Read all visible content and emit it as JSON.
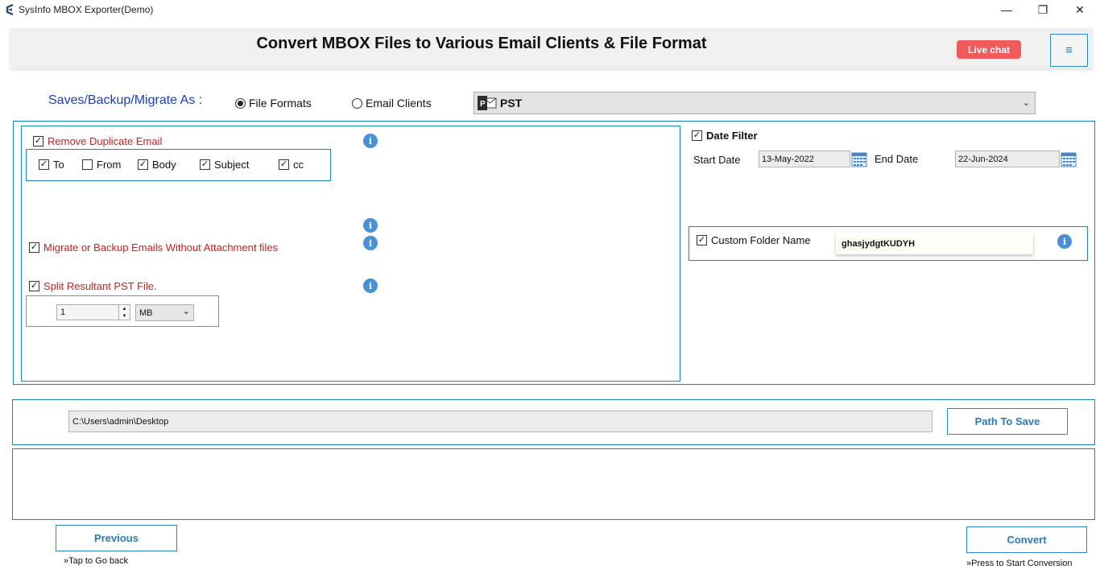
{
  "window": {
    "title": "SysInfo MBOX Exporter(Demo)",
    "minimize": "—",
    "restore": "❐",
    "close": "✕"
  },
  "header": {
    "title": "Convert MBOX Files to Various Email Clients & File Format",
    "live_chat": "Live chat",
    "menu_icon": "hamburger-icon",
    "menu_glyph": "≡"
  },
  "save_as": {
    "label": "Saves/Backup/Migrate As :",
    "options": [
      {
        "label": "File Formats",
        "selected": true
      },
      {
        "label": "Email Clients",
        "selected": false
      }
    ],
    "format_selected": "PST"
  },
  "options": {
    "remove_duplicate": {
      "label": "Remove Duplicate Email",
      "checked": true
    },
    "duplicate_fields": [
      {
        "label": "To",
        "checked": true
      },
      {
        "label": "From",
        "checked": false
      },
      {
        "label": "Body",
        "checked": true
      },
      {
        "label": "Subject",
        "checked": true
      },
      {
        "label": "cc",
        "checked": true
      }
    ],
    "without_attachment": {
      "label": "Migrate or Backup Emails Without Attachment files",
      "checked": true
    },
    "split": {
      "label": "Split Resultant PST File.",
      "checked": true,
      "size_value": "1",
      "unit": "MB"
    }
  },
  "date_filter": {
    "label": "Date Filter",
    "checked": true,
    "start_label": "Start Date",
    "start_value": "13-May-2022",
    "end_label": "End Date",
    "end_value": "22-Jun-2024"
  },
  "custom_folder": {
    "label": "Custom Folder Name",
    "checked": true,
    "value": "ghasjydgtKUDYH"
  },
  "path": {
    "value": "C:\\Users\\admin\\Desktop",
    "button": "Path To Save"
  },
  "footer": {
    "previous": "Previous",
    "previous_hint": "»Tap to Go back",
    "convert": "Convert",
    "convert_hint": "»Press to Start Conversion"
  },
  "colors": {
    "accent": "#1a86b8",
    "live_chat": "#f15b5b",
    "warning_text": "#cc1f1f",
    "label_blue": "#1a3fb0"
  },
  "info_glyph": "i",
  "check_glyph": "✓",
  "chevron_glyph": "⌄"
}
